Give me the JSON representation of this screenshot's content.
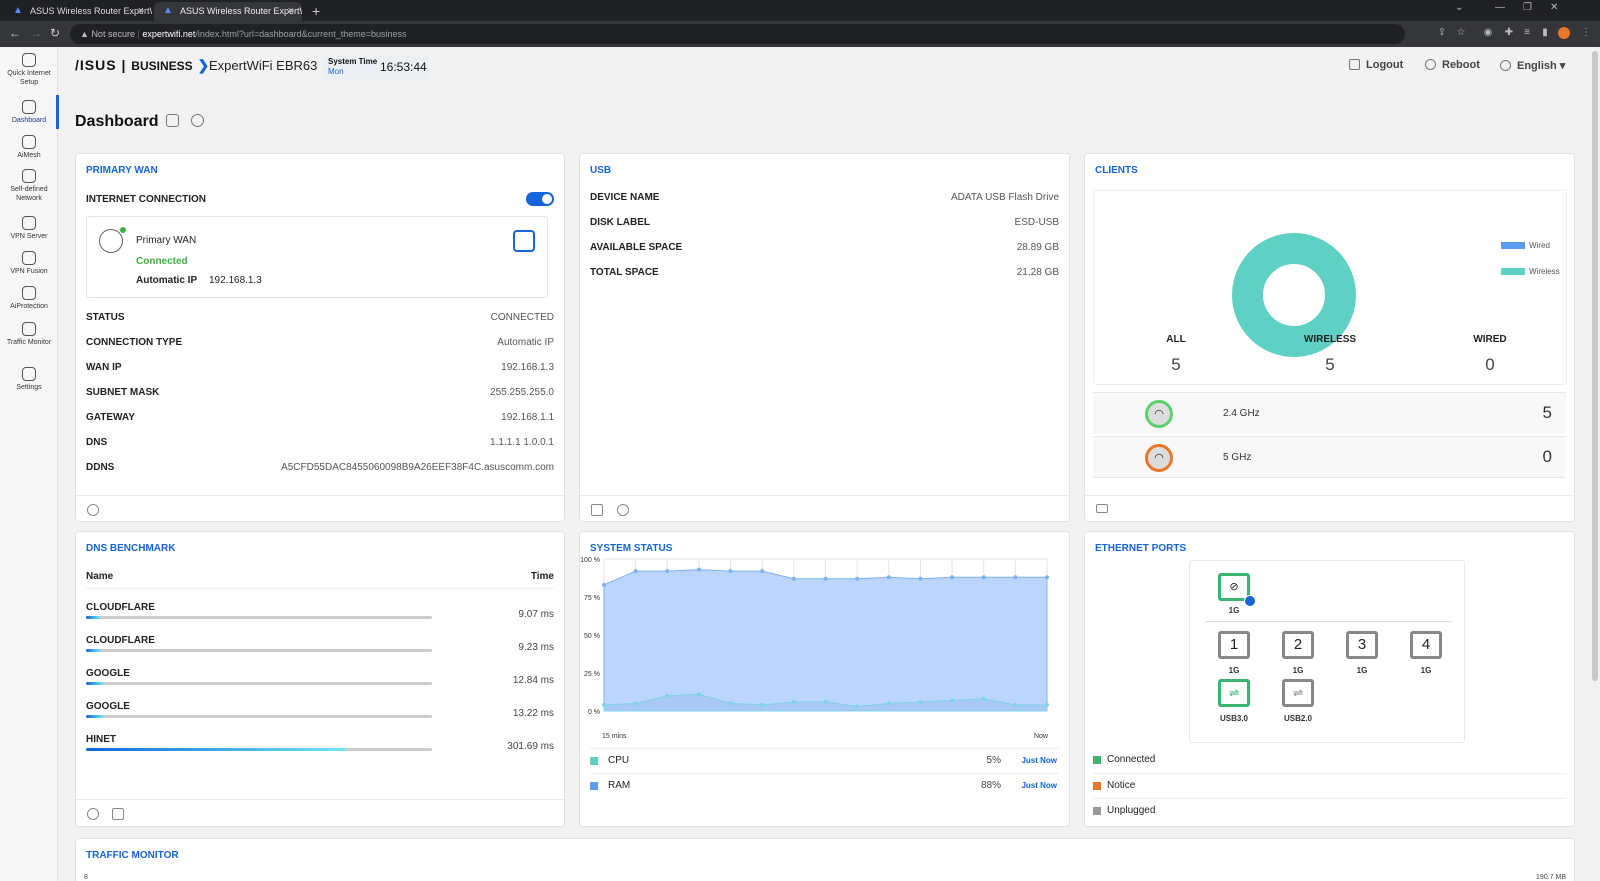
{
  "browser": {
    "tabs": [
      {
        "title": "ASUS Wireless Router ExpertWi"
      },
      {
        "title": "ASUS Wireless Router ExpertWi"
      }
    ],
    "url_security": "Not secure",
    "url_host": "expertwifi.net",
    "url_path": "/index.html?url=dashboard&current_theme=business"
  },
  "sidebar": {
    "items": [
      {
        "label": "Quick Internet Setup"
      },
      {
        "label": "Dashboard"
      },
      {
        "label": "AiMesh"
      },
      {
        "label": "Self-defined Network"
      },
      {
        "label": "VPN Server"
      },
      {
        "label": "VPN Fusion"
      },
      {
        "label": "AiProtection"
      },
      {
        "label": "Traffic Monitor"
      },
      {
        "label": "Settings"
      }
    ]
  },
  "header": {
    "brand": "/ISUS",
    "brand_suffix": "BUSINESS",
    "model": "ExpertWiFi EBR63",
    "system_time_label": "System Time",
    "system_day": "Mon",
    "system_time": "16:53:44",
    "logout": "Logout",
    "reboot": "Reboot",
    "language": "English"
  },
  "page_title": "Dashboard",
  "wan": {
    "title": "PRIMARY WAN",
    "internet_connection_label": "INTERNET CONNECTION",
    "internet_on": true,
    "name": "Primary WAN",
    "state": "Connected",
    "ip_label": "Automatic IP",
    "ip_value": "192.168.1.3",
    "rows": [
      {
        "k": "STATUS",
        "v": "CONNECTED"
      },
      {
        "k": "CONNECTION TYPE",
        "v": "Automatic IP"
      },
      {
        "k": "WAN IP",
        "v": "192.168.1.3"
      },
      {
        "k": "SUBNET MASK",
        "v": "255.255.255.0"
      },
      {
        "k": "GATEWAY",
        "v": "192.168.1.1"
      },
      {
        "k": "DNS",
        "v": "1.1.1.1 1.0.0.1"
      },
      {
        "k": "DDNS",
        "v": "A5CFD55DAC8455060098B9A26EEF38F4C.asuscomm.com"
      }
    ]
  },
  "usb": {
    "title": "USB",
    "rows": [
      {
        "k": "DEVICE NAME",
        "v": "ADATA USB Flash Drive"
      },
      {
        "k": "DISK LABEL",
        "v": "ESD-USB"
      },
      {
        "k": "AVAILABLE SPACE",
        "v": "28.89 GB"
      },
      {
        "k": "TOTAL SPACE",
        "v": "21.28 GB"
      }
    ]
  },
  "clients": {
    "title": "CLIENTS",
    "legend": [
      {
        "name": "Wired",
        "color": "#5b9cf0"
      },
      {
        "name": "Wireless",
        "color": "#5fd0c4"
      }
    ],
    "stats": [
      {
        "k": "ALL",
        "v": "5"
      },
      {
        "k": "WIRELESS",
        "v": "5"
      },
      {
        "k": "WIRED",
        "v": "0"
      }
    ],
    "bands": [
      {
        "name": "2.4 GHz",
        "count": "5",
        "ring": "#5ccf6e"
      },
      {
        "name": "5 GHz",
        "count": "0",
        "ring": "#e8772a"
      }
    ]
  },
  "dns": {
    "title": "DNS BENCHMARK",
    "col_name": "Name",
    "col_time": "Time",
    "rows": [
      {
        "name": "CLOUDFLARE",
        "time": "9.07 ms",
        "fill": 0.04
      },
      {
        "name": "CLOUDFLARE",
        "time": "9.23 ms",
        "fill": 0.04
      },
      {
        "name": "GOOGLE",
        "time": "12.84 ms",
        "fill": 0.05
      },
      {
        "name": "GOOGLE",
        "time": "13.22 ms",
        "fill": 0.05
      },
      {
        "name": "HINET",
        "time": "301.69 ms",
        "fill": 0.75
      }
    ]
  },
  "system": {
    "title": "SYSTEM STATUS",
    "y_ticks": [
      "100 %",
      "75 %",
      "50 %",
      "25 %",
      "0 %"
    ],
    "x_start": "15 mins",
    "x_end": "Now",
    "cpu_label": "CPU",
    "cpu_value": "5%",
    "ram_label": "RAM",
    "ram_value": "88%",
    "just_now": "Just Now",
    "ram_color": "#5b9cf0",
    "cpu_color": "#5fd0c4"
  },
  "chart_data": {
    "type": "area",
    "ylim": [
      0,
      100
    ],
    "series": [
      {
        "name": "RAM",
        "values": [
          83,
          92,
          92,
          93,
          92,
          92,
          87,
          87,
          87,
          88,
          87,
          88,
          88,
          88,
          88
        ]
      },
      {
        "name": "CPU",
        "values": [
          4,
          5,
          10,
          11,
          5,
          4,
          6,
          6,
          3,
          5,
          6,
          7,
          8,
          4,
          4
        ]
      }
    ]
  },
  "ethernet": {
    "title": "ETHERNET PORTS",
    "wan_port": {
      "label": "1G",
      "status": "connected"
    },
    "lan_ports": [
      {
        "num": "1",
        "label": "1G"
      },
      {
        "num": "2",
        "label": "1G"
      },
      {
        "num": "3",
        "label": "1G"
      },
      {
        "num": "4",
        "label": "1G"
      }
    ],
    "usb_ports": [
      {
        "label": "USB3.0",
        "status": "connected"
      },
      {
        "label": "USB2.0",
        "status": "unplugged"
      }
    ],
    "legend": [
      {
        "name": "Connected",
        "color": "#3cb371"
      },
      {
        "name": "Notice",
        "color": "#e8772a"
      },
      {
        "name": "Unplugged",
        "color": "#999999"
      }
    ]
  },
  "traffic": {
    "title": "TRAFFIC MONITOR",
    "y_left": "8",
    "y_right": "190.7 MB"
  }
}
